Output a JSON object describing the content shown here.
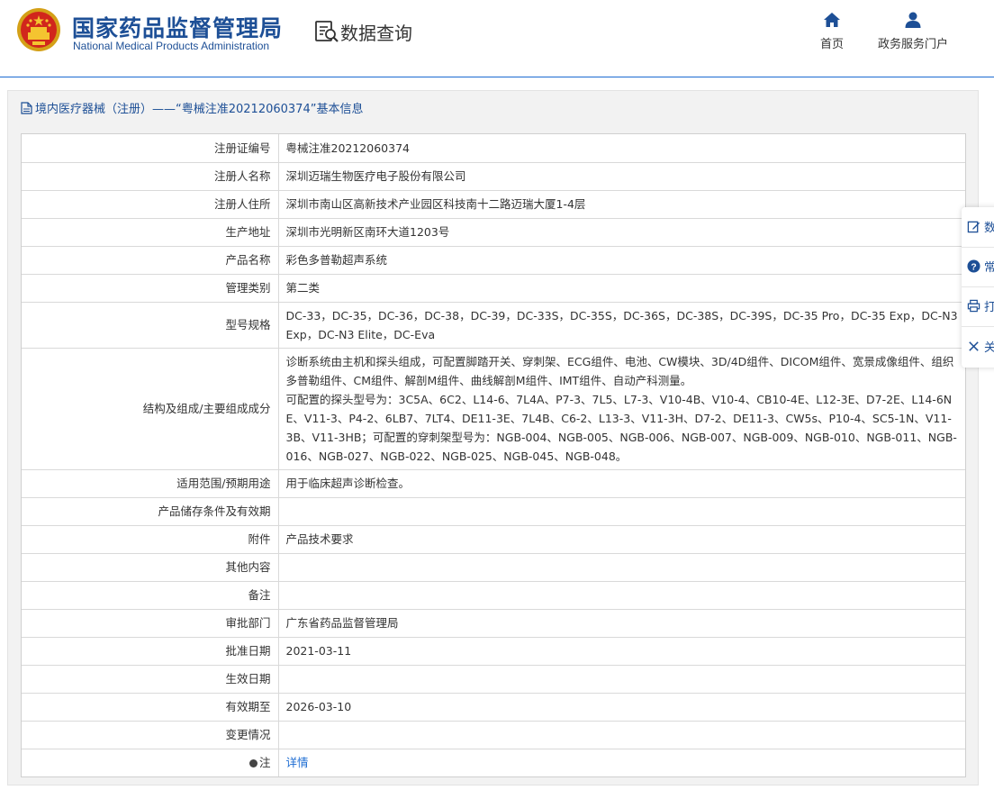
{
  "header": {
    "org_name_cn": "国家药品监督管理局",
    "org_name_en": "National Medical Products Administration",
    "section_title": "数据查询",
    "nav": [
      {
        "label": "首页",
        "icon": "home-icon"
      },
      {
        "label": "政务服务门户",
        "icon": "user-icon"
      }
    ]
  },
  "panel": {
    "title": "境内医疗器械（注册）——“粤械注准20212060374”基本信息"
  },
  "table": {
    "rows": [
      {
        "label": "注册证编号",
        "value": "粤械注准20212060374"
      },
      {
        "label": "注册人名称",
        "value": "深圳迈瑞生物医疗电子股份有限公司"
      },
      {
        "label": "注册人住所",
        "value": "深圳市南山区高新技术产业园区科技南十二路迈瑞大厦1-4层"
      },
      {
        "label": "生产地址",
        "value": "深圳市光明新区南环大道1203号"
      },
      {
        "label": "产品名称",
        "value": "彩色多普勒超声系统"
      },
      {
        "label": "管理类别",
        "value": "第二类"
      },
      {
        "label": "型号规格",
        "value": "DC-33，DC-35，DC-36，DC-38，DC-39，DC-33S，DC-35S，DC-36S，DC-38S，DC-39S，DC-35 Pro，DC-35 Exp，DC-N3 Exp，DC-N3 Elite，DC-Eva"
      },
      {
        "label": "结构及组成/主要组成成分",
        "value": "诊断系统由主机和探头组成，可配置脚踏开关、穿刺架、ECG组件、电池、CW模块、3D/4D组件、DICOM组件、宽景成像组件、组织多普勒组件、CM组件、解剖M组件、曲线解剖M组件、IMT组件、自动产科测量。\n可配置的探头型号为：3C5A、6C2、L14-6、7L4A、P7-3、7L5、L7-3、V10-4B、V10-4、CB10-4E、L12-3E、D7-2E、L14-6NE、V11-3、P4-2、6LB7、7LT4、DE11-3E、7L4B、C6-2、L13-3、V11-3H、D7-2、DE11-3、CW5s、P10-4、SC5-1N、V11-3B、V11-3HB；可配置的穿刺架型号为：NGB-004、NGB-005、NGB-006、NGB-007、NGB-009、NGB-010、NGB-011、NGB-016、NGB-027、NGB-022、NGB-025、NGB-045、NGB-048。"
      },
      {
        "label": "适用范围/预期用途",
        "value": "用于临床超声诊断检查。"
      },
      {
        "label": "产品储存条件及有效期",
        "value": ""
      },
      {
        "label": "附件",
        "value": "产品技术要求"
      },
      {
        "label": "其他内容",
        "value": ""
      },
      {
        "label": "备注",
        "value": ""
      },
      {
        "label": "审批部门",
        "value": "广东省药品监督管理局"
      },
      {
        "label": "批准日期",
        "value": "2021-03-11"
      },
      {
        "label": "生效日期",
        "value": ""
      },
      {
        "label": "有效期至",
        "value": "2026-03-10"
      },
      {
        "label": "变更情况",
        "value": ""
      }
    ],
    "note_row": {
      "label": "注",
      "value": "详情"
    }
  },
  "float_bar": {
    "items": [
      {
        "label": "数",
        "icon": "edit-icon"
      },
      {
        "label": "常",
        "icon": "question-icon"
      },
      {
        "label": "打",
        "icon": "print-icon"
      },
      {
        "label": "关",
        "icon": "close-icon"
      }
    ]
  },
  "colors": {
    "brand_blue": "#1d4f96",
    "link_blue": "#1b6bd2",
    "panel_bg": "#f2f2f2"
  }
}
